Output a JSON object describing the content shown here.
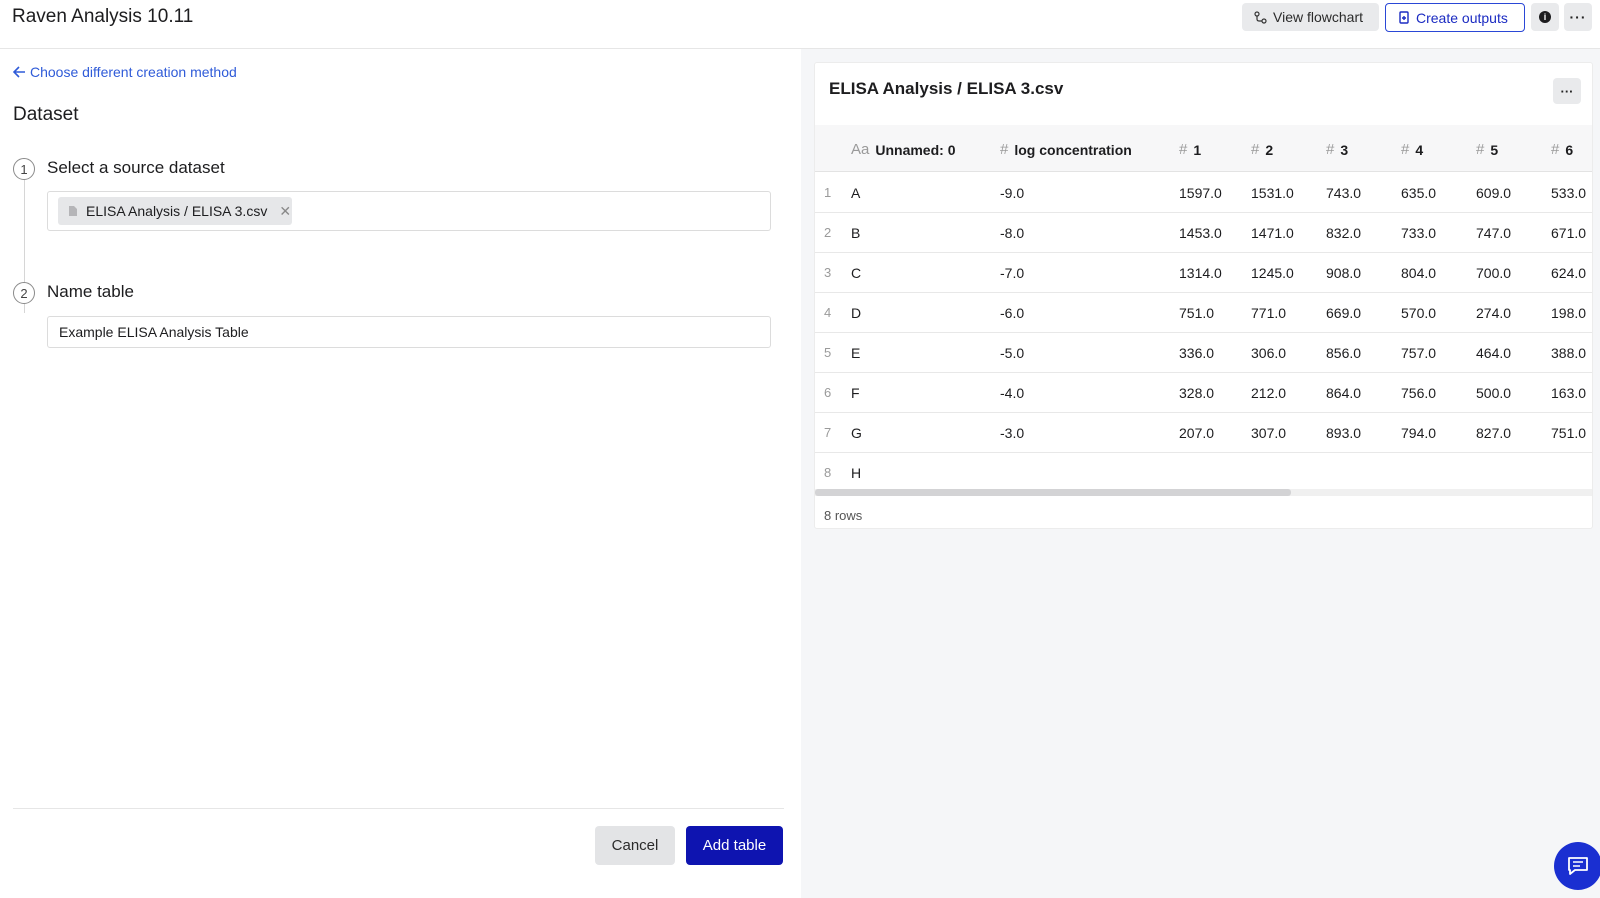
{
  "header": {
    "title": "Raven Analysis 10.11",
    "view_flowchart_label": "View flowchart",
    "create_outputs_label": "Create outputs",
    "info_icon": "info-icon",
    "more_icon": "ellipsis-icon"
  },
  "form": {
    "back_link": "Choose different creation method",
    "section_title": "Dataset",
    "step1": {
      "number": "1",
      "label": "Select a source dataset"
    },
    "step2": {
      "number": "2",
      "label": "Name table"
    },
    "selected_dataset": "ELISA Analysis / ELISA 3.csv",
    "table_name_value": "Example ELISA Analysis Table",
    "cancel_label": "Cancel",
    "add_label": "Add table"
  },
  "preview": {
    "title": "ELISA Analysis / ELISA 3.csv",
    "columns": [
      {
        "icon": "Aa",
        "label": "Unnamed: 0"
      },
      {
        "icon": "#",
        "label": "log concentration"
      },
      {
        "icon": "#",
        "label": "1"
      },
      {
        "icon": "#",
        "label": "2"
      },
      {
        "icon": "#",
        "label": "3"
      },
      {
        "icon": "#",
        "label": "4"
      },
      {
        "icon": "#",
        "label": "5"
      },
      {
        "icon": "#",
        "label": "6"
      }
    ],
    "rows": [
      {
        "n": "1",
        "cells": [
          "A",
          "-9.0",
          "1597.0",
          "1531.0",
          "743.0",
          "635.0",
          "609.0",
          "533.0"
        ]
      },
      {
        "n": "2",
        "cells": [
          "B",
          "-8.0",
          "1453.0",
          "1471.0",
          "832.0",
          "733.0",
          "747.0",
          "671.0"
        ]
      },
      {
        "n": "3",
        "cells": [
          "C",
          "-7.0",
          "1314.0",
          "1245.0",
          "908.0",
          "804.0",
          "700.0",
          "624.0"
        ]
      },
      {
        "n": "4",
        "cells": [
          "D",
          "-6.0",
          "751.0",
          "771.0",
          "669.0",
          "570.0",
          "274.0",
          "198.0"
        ]
      },
      {
        "n": "5",
        "cells": [
          "E",
          "-5.0",
          "336.0",
          "306.0",
          "856.0",
          "757.0",
          "464.0",
          "388.0"
        ]
      },
      {
        "n": "6",
        "cells": [
          "F",
          "-4.0",
          "328.0",
          "212.0",
          "864.0",
          "756.0",
          "500.0",
          "163.0"
        ]
      },
      {
        "n": "7",
        "cells": [
          "G",
          "-3.0",
          "207.0",
          "307.0",
          "893.0",
          "794.0",
          "827.0",
          "751.0"
        ]
      },
      {
        "n": "8",
        "cells": [
          "H",
          "",
          "",
          "",
          "",
          "",
          "",
          ""
        ]
      }
    ],
    "row_count": "8 rows"
  },
  "colors": {
    "primary": "#0e14b0",
    "link": "#2f5bd8",
    "outline_button": "#2a47d6"
  }
}
